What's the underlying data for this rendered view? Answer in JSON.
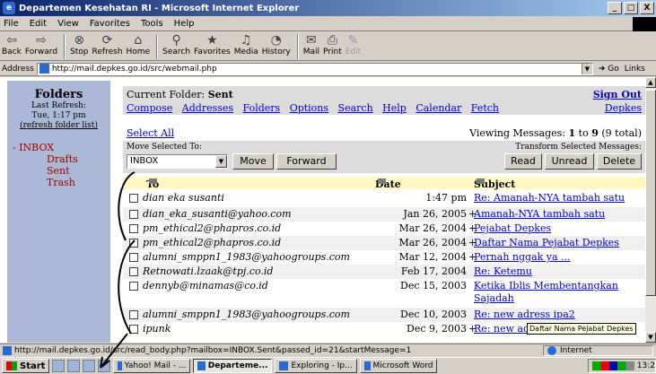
{
  "window": {
    "title": "Departemen Kesehatan RI - Microsoft Internet Explorer",
    "min": "_",
    "max": "□",
    "close": "X"
  },
  "menu": [
    "File",
    "Edit",
    "View",
    "Favorites",
    "Tools",
    "Help"
  ],
  "toolbar": [
    {
      "label": "Back",
      "icon": "back-arrow-icon",
      "glyph": "⇦"
    },
    {
      "label": "Forward",
      "icon": "forward-arrow-icon",
      "glyph": "⇨"
    },
    {
      "label": "Stop",
      "icon": "stop-icon",
      "glyph": "⊗"
    },
    {
      "label": "Refresh",
      "icon": "refresh-icon",
      "glyph": "⟳"
    },
    {
      "label": "Home",
      "icon": "home-icon",
      "glyph": "⌂"
    },
    {
      "label": "Search",
      "icon": "search-icon",
      "glyph": "⚲"
    },
    {
      "label": "Favorites",
      "icon": "favorites-icon",
      "glyph": "★"
    },
    {
      "label": "Media",
      "icon": "media-icon",
      "glyph": "♫"
    },
    {
      "label": "History",
      "icon": "history-icon",
      "glyph": "◔"
    },
    {
      "label": "Mail",
      "icon": "mail-icon",
      "glyph": "✉"
    },
    {
      "label": "Print",
      "icon": "print-icon",
      "glyph": "⎙"
    },
    {
      "label": "Edit",
      "icon": "edit-icon",
      "glyph": "✎"
    }
  ],
  "address": {
    "label": "Address",
    "url": "http://mail.depkes.go.id/src/webmail.php",
    "go": "Go",
    "links": "Links"
  },
  "folders": {
    "heading": "Folders",
    "last_refresh_label": "Last Refresh:",
    "last_refresh_time": "Tue, 1:17 pm",
    "refresh_link": "(refresh folder list)",
    "items": [
      "- INBOX",
      "Drafts",
      "Sent",
      "Trash"
    ]
  },
  "main": {
    "current_folder_label": "Current Folder:",
    "current_folder": "Sent",
    "sign_out": "Sign Out",
    "nav": [
      "Compose",
      "Addresses",
      "Folders",
      "Options",
      "Search",
      "Help",
      "Calendar",
      "Fetch"
    ],
    "depkes": "Depkes",
    "select_all": "Select All",
    "viewing": {
      "prefix": "Viewing Messages:",
      "from": "1",
      "to_word": "to",
      "to": "9",
      "total": "(9 total)"
    },
    "move_selected_label": "Move Selected To:",
    "move_target": "INBOX",
    "move_button": "Move",
    "forward_button": "Forward",
    "transform_label": "Transform Selected Messages:",
    "read_button": "Read",
    "unread_button": "Unread",
    "delete_button": "Delete",
    "columns": {
      "to": "To",
      "date": "Date",
      "subject": "Subject"
    }
  },
  "messages": [
    {
      "to": "dian eka susanti",
      "date": "1:47 pm",
      "plus": "",
      "subject": "Re: Amanah-NYA tambah satu"
    },
    {
      "to": "dian_eka_susanti@yahoo.com",
      "date": "Jan 26, 2005",
      "plus": "+",
      "subject": "Amanah-NYA tambah satu"
    },
    {
      "to": "pm_ethical2@phapros.co.id",
      "date": "Mar 26, 2004",
      "plus": "+",
      "subject": "Pejabat Depkes"
    },
    {
      "to": "pm_ethical2@phapros.co.id",
      "date": "Mar 26, 2004",
      "plus": "+",
      "subject": "Daftar Nama Pejabat Depkes"
    },
    {
      "to": "alumni_smppn1_1983@yahoogroups.com",
      "date": "Mar 12, 2004",
      "plus": "+",
      "subject": "Pernah nggak ya ..."
    },
    {
      "to": "Retnowati.lzaak@tpj.co.id",
      "date": "Feb 17, 2004",
      "plus": "",
      "subject": "Re: Ketemu"
    },
    {
      "to": "dennyb@minamas@co.id",
      "date": "Dec 15, 2003",
      "plus": "",
      "subject": "Ketika Iblis Membentangkan Sajadah"
    },
    {
      "to": "alumni_smppn1_1983@yahoogroups.com",
      "date": "Dec 10, 2003",
      "plus": "",
      "subject": "Re: new adress ipa2"
    },
    {
      "to": "ipunk",
      "date": "Dec 9, 2003",
      "plus": "+",
      "subject": "Re: new adress ipa2"
    }
  ],
  "tooltip": "Daftar Nama Pejabat Depkes",
  "status": {
    "url": "http://mail.depkes.go.id/src/read_body.php?mailbox=INBOX.Sent&passed_id=21&startMessage=1",
    "zone": "Internet"
  },
  "taskbar": {
    "start": "Start",
    "tasks": [
      "Yahoo! Mail - ...",
      "Departeme...",
      "Exploring - Ip...",
      "Microsoft Word"
    ],
    "clock": "13:2"
  }
}
